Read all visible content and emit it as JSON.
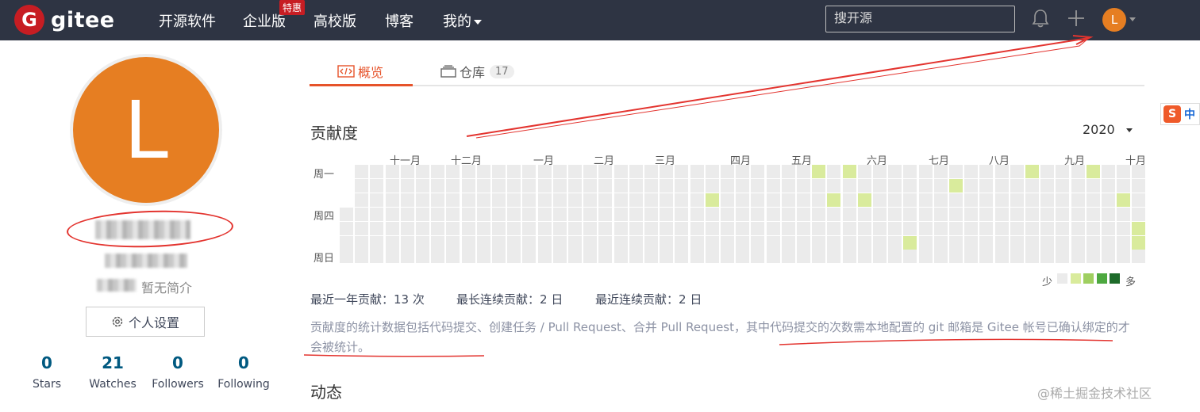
{
  "nav": {
    "logo_letter": "G",
    "logo_text": "gitee",
    "items": [
      "开源软件",
      "企业版",
      "高校版",
      "博客"
    ],
    "badge": "特惠",
    "mine": "我的",
    "search_placeholder": "搜开源",
    "user_initial": "L"
  },
  "profile": {
    "avatar_letter": "L",
    "bio": "暂无简介",
    "settings_label": "个人设置",
    "stats": [
      {
        "value": "0",
        "label": "Stars"
      },
      {
        "value": "21",
        "label": "Watches"
      },
      {
        "value": "0",
        "label": "Followers"
      },
      {
        "value": "0",
        "label": "Following"
      }
    ]
  },
  "tabs": {
    "overview": "概览",
    "repos": "仓库",
    "repo_count": "17"
  },
  "contribution": {
    "title": "贡献度",
    "year": "2020",
    "months": [
      "十一月",
      "十二月",
      "一月",
      "二月",
      "三月",
      "四月",
      "五月",
      "六月",
      "七月",
      "八月",
      "九月",
      "十月"
    ],
    "day_labels": [
      "周一",
      "周四",
      "周日"
    ],
    "legend_less": "少",
    "legend_more": "多",
    "colors": [
      "#ebebeb",
      "#d9eb9c",
      "#9fcf60",
      "#4da840",
      "#1e6b2a"
    ],
    "active_cells": [
      {
        "col": 31,
        "row": 0,
        "level": 1
      },
      {
        "col": 33,
        "row": 0,
        "level": 1
      },
      {
        "col": 45,
        "row": 0,
        "level": 1
      },
      {
        "col": 49,
        "row": 0,
        "level": 1
      },
      {
        "col": 40,
        "row": 1,
        "level": 1
      },
      {
        "col": 24,
        "row": 2,
        "level": 1
      },
      {
        "col": 32,
        "row": 2,
        "level": 1
      },
      {
        "col": 34,
        "row": 2,
        "level": 1
      },
      {
        "col": 51,
        "row": 2,
        "level": 1
      },
      {
        "col": 52,
        "row": 4,
        "level": 1
      },
      {
        "col": 37,
        "row": 5,
        "level": 1
      },
      {
        "col": 52,
        "row": 5,
        "level": 1
      }
    ],
    "summary": [
      {
        "label": "最近一年贡献：",
        "value": "13 次"
      },
      {
        "label": "最长连续贡献：",
        "value": "2 日"
      },
      {
        "label": "最近连续贡献：",
        "value": "2 日"
      }
    ],
    "note": "贡献度的统计数据包括代码提交、创建任务 / Pull Request、合并 Pull Request，其中代码提交的次数需本地配置的 git 邮箱是 Gitee 帐号已确认绑定的才会被统计。"
  },
  "activity_title": "动态",
  "ime": {
    "logo": "S",
    "lang": "中"
  },
  "watermark": "@稀土掘金技术社区"
}
